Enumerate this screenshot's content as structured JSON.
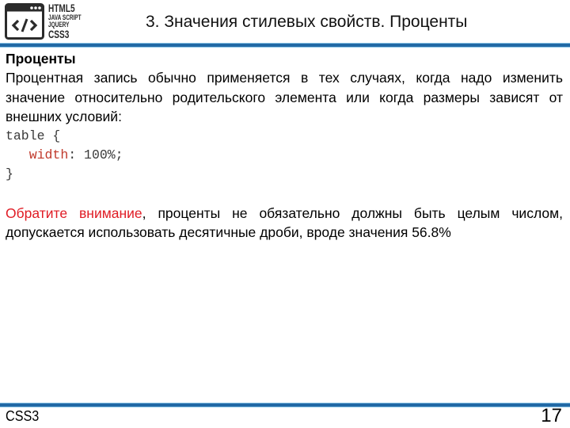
{
  "logo": {
    "icon": "code-window-icon",
    "lines": [
      "HTML5",
      "JAVA SCRIPT",
      "JQUERY",
      "CSS3"
    ]
  },
  "header": {
    "title": "3. Значения стилевых свойств. Проценты"
  },
  "content": {
    "heading": "Проценты",
    "paragraph": "Процентная запись обычно применяется в тех случаях, когда надо изменить значение относительно родительского элемента или когда размеры зависят от внешних условий:",
    "code": {
      "line1": "table {",
      "indent": "   ",
      "property": "width",
      "value": ": 100%;",
      "line3": "}"
    },
    "note": {
      "highlight": "Обратите внимание",
      "text": ", проценты не обязательно должны быть целым числом, допускается использовать десятичные дроби, вроде значения 56.8%"
    }
  },
  "footer": {
    "label": "CSS3",
    "page_number": "17"
  },
  "colors": {
    "rule": "#2169a5",
    "highlight": "#e01b24",
    "code_property": "#c0392b"
  }
}
